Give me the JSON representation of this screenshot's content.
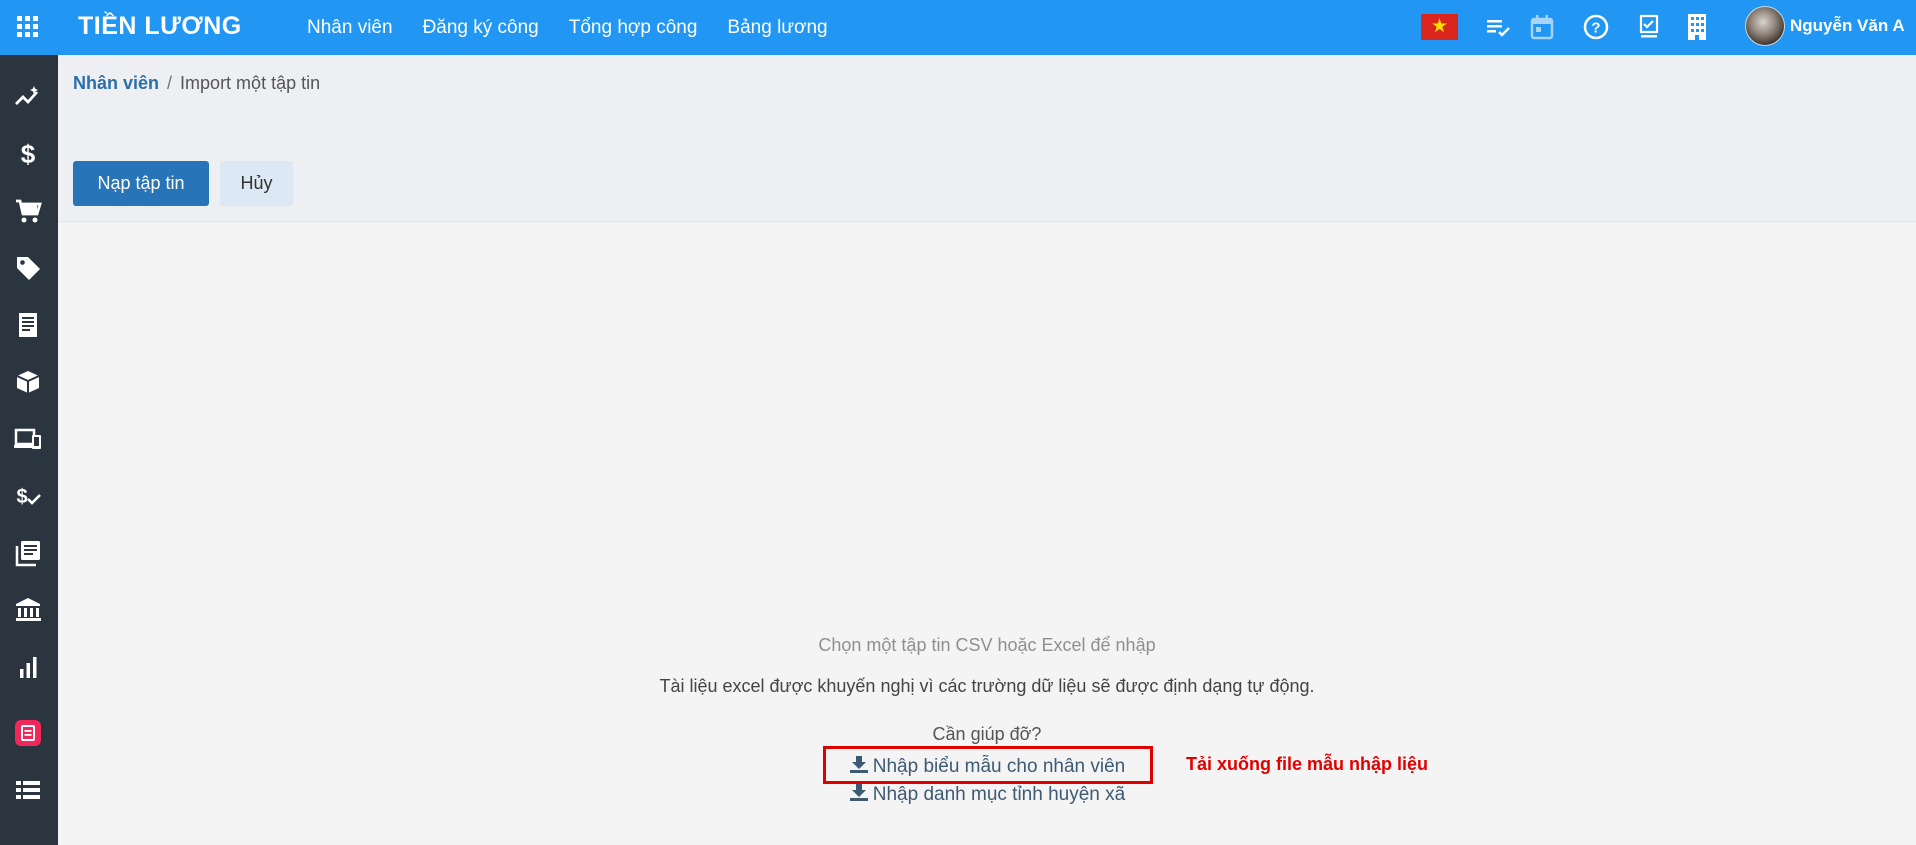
{
  "app": {
    "title": "TIỀN LƯƠNG",
    "menu": [
      "Nhân viên",
      "Đăng ký công",
      "Tổng hợp công",
      "Bảng lương"
    ],
    "user_name": "Nguyễn Văn A",
    "brand_color": "#2196f3",
    "sidebar_color": "#2b3540"
  },
  "systray": {
    "icons": [
      "vietnam-flag-icon",
      "task-list-icon",
      "calendar-icon",
      "help-icon",
      "checklist-icon",
      "company-icon"
    ]
  },
  "sidebar": {
    "icons": [
      "dashboard-icon",
      "dollar-icon",
      "cart-icon",
      "tag-icon",
      "invoice-icon",
      "inventory-icon",
      "devices-icon",
      "payment-check-icon",
      "books-icon",
      "bank-icon",
      "bar-chart-icon",
      "red-app-icon",
      "list-icon"
    ]
  },
  "breadcrumb": {
    "parent": "Nhân viên",
    "separator": "/",
    "current": "Import một tập tin"
  },
  "buttons": {
    "load_file": "Nạp tập tin",
    "cancel": "Hủy"
  },
  "main": {
    "choose_hint": "Chọn một tập tin CSV hoặc Excel để nhập",
    "recommend_hint": "Tài liệu excel được khuyến nghị vì các trường dữ liệu sẽ được định dạng tự động.",
    "help_text": "Cần giúp đỡ?",
    "links": [
      "Nhập biểu mẫu cho nhân viên",
      "Nhập danh mục tỉnh huyện xã"
    ],
    "annotation": "Tải xuống file mẫu nhập liệu",
    "annotation_color": "#e00000"
  }
}
